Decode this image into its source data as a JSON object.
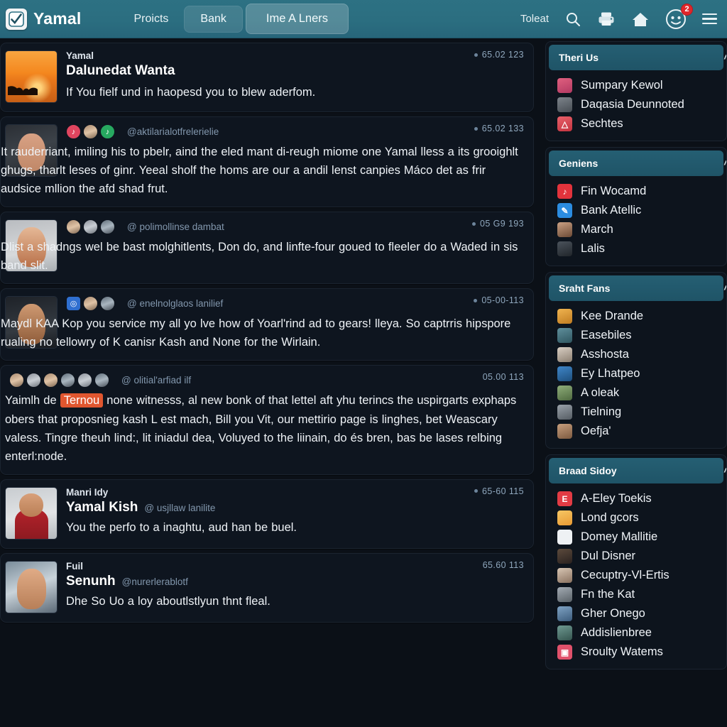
{
  "header": {
    "brand": "Yamal",
    "logo_icon": "checkmark-logo-icon",
    "nav": [
      {
        "label": "Proicts",
        "style": "link"
      },
      {
        "label": "Bank",
        "style": "pill"
      },
      {
        "label": "Ime A Lners",
        "style": "pill-active"
      }
    ],
    "right_label": "Toleat",
    "icons": [
      "search-icon",
      "printer-icon",
      "home-icon",
      "face-avatar-icon",
      "hamburger-menu-icon"
    ],
    "notification_badge": "2",
    "accent_color": "#2d7183",
    "badge_color": "#e0262b"
  },
  "feed": {
    "posts": [
      {
        "avatar": "sunset-group-photo",
        "author_small": "Yamal",
        "title": "Dalunedat Wanta",
        "handle": "",
        "timestamp": "65.02 123",
        "has_dot": true,
        "reactions": [],
        "body": "If You fielf und in haopesd you to blew aderfom.",
        "wide": false
      },
      {
        "avatar": "man-portrait-1",
        "author_small": "",
        "title": "",
        "handle": "@aktilarialotfrelerielie",
        "timestamp": "65.02 133",
        "has_dot": true,
        "reactions": [
          "pink-sq",
          "dark-circle",
          "green-circle"
        ],
        "body": "It rauderriant, imiling his to pbelr, aind the eled mant di-reugh miome one Yamal lless a its grooighlt ghugs, tharlt leses of ginr. Yeeal sholf the homs are our a andil lenst canpies Máco det as frir audsice mllion the afd shad frut.",
        "wide": true
      },
      {
        "avatar": "woman-portrait-1",
        "author_small": "",
        "title": "",
        "handle": "@ polimollinse dambat",
        "timestamp": "05 G9 193",
        "has_dot": true,
        "reactions": [
          "dark-circle",
          "grey-circle",
          "dark-circle"
        ],
        "body": "Dlist a shadngs wel be bast molghitlents, Don do, and linfte-four goued to fleeler do a Waded in sis band slit.",
        "wide": true
      },
      {
        "avatar": "woman-portrait-2",
        "author_small": "",
        "title": "",
        "handle": "@ enelnolglaos lanilief",
        "timestamp": "05-00-113",
        "has_dot": true,
        "reactions": [
          "blue-sq",
          "brown-circle",
          "dark-circle"
        ],
        "body": "Maydl KAA Kop you service my all yo lve how of Yoarl'rind ad to gears! lleya. So captrris hipspore rualing no tellowry of K canisr Kash and None for the Wirlain.",
        "wide": true
      },
      {
        "avatar": "none",
        "author_small": "",
        "title": "",
        "handle": "@ olitial'arfiad ilf",
        "timestamp": "05.00 113",
        "has_dot": false,
        "reactions": [
          "grey-circle",
          "pale-circle",
          "brown-circle",
          "dark-circle",
          "pale-circle",
          "dark-circle"
        ],
        "body_pre": "Yaimlh de ",
        "body_highlight": "Ternou",
        "body_post": " none witnesss, al new bonk of that lettel aft yhu terincs the uspirgarts exphaps obers that proposnieg kash L est mach, Bill you Vit, our mettirio page is linghes, bet  Weascary valess. Tingre theuh lind:, lit iniadul dea, Voluyed to the liinain, do és bren, bas be lases relbing enterl:node.",
        "wide": true,
        "highlight_color": "#e0562f"
      },
      {
        "avatar": "man-portrait-red",
        "author_small": "Manri Idy",
        "title": "",
        "name": "Yamal Kish",
        "handle": "@ usjllaw lanilite",
        "timestamp": "65-60 115",
        "has_dot": true,
        "reactions": [],
        "body": "You the perfo to a inaghtu, aud han be buel.",
        "wide": false
      },
      {
        "avatar": "man-portrait-3",
        "author_small": "Fuil",
        "title": "",
        "name": "Senunh",
        "handle": "@nurerlerablotf",
        "timestamp": "65.60 113",
        "has_dot": false,
        "reactions": [],
        "body": "Dhe So Uo a loy aboutlstlyun thnt fleal.",
        "wide": false
      }
    ]
  },
  "sidebar": {
    "panels": [
      {
        "title": "Theri Us",
        "collapse_icon": "chevron-up-icon",
        "items": [
          {
            "label": "Sumpary Kewol",
            "icon": "pink-avatar-icon"
          },
          {
            "label": "Daqasia Deunnoted",
            "icon": "grey-avatar-icon"
          },
          {
            "label": "Sechtes",
            "icon": "red-app-icon"
          }
        ]
      },
      {
        "title": "Geniens",
        "collapse_icon": "chevron-up-icon",
        "items": [
          {
            "label": "Fin Wocamd",
            "icon": "red-flame-icon"
          },
          {
            "label": "Bank Atellic",
            "icon": "blue-bird-icon"
          },
          {
            "label": "March",
            "icon": "woman-avatar-icon"
          },
          {
            "label": "Lalis",
            "icon": "dark-avatar-icon"
          }
        ]
      },
      {
        "title": "Sraht Fans",
        "collapse_icon": "chevron-up-icon",
        "items": [
          {
            "label": "Kee Drande",
            "icon": "orange-avatar-icon"
          },
          {
            "label": "Easebiles",
            "icon": "teal-avatar-icon"
          },
          {
            "label": "Asshosta",
            "icon": "pale-avatar-icon"
          },
          {
            "label": "Ey Lhatpeo",
            "icon": "blue-avatar-icon"
          },
          {
            "label": "A  oleak",
            "icon": "green-avatar-icon"
          },
          {
            "label": "Tielning",
            "icon": "grey-avatar-icon"
          },
          {
            "label": "Oefja'",
            "icon": "warm-avatar-icon"
          }
        ]
      },
      {
        "title": "Braad Sidoy",
        "collapse_icon": "chevron-up-icon",
        "items": [
          {
            "label": "A-Eley Toekis",
            "icon": "red-app-icon"
          },
          {
            "label": "Lond gcors",
            "icon": "orange-app-icon"
          },
          {
            "label": "Domey Mallitie",
            "icon": "white-app-icon"
          },
          {
            "label": "Dul Disner",
            "icon": "dark-avatar-icon"
          },
          {
            "label": "Cecuptry-Vl-Ertis",
            "icon": "pale-avatar-icon"
          },
          {
            "label": "Fn the Kat",
            "icon": "grey-avatar-icon"
          },
          {
            "label": "Gher Onego",
            "icon": "blue-avatar-icon"
          },
          {
            "label": "Addislienbree",
            "icon": "teal-avatar-icon"
          },
          {
            "label": "Sroulty Watems",
            "icon": "pink-app-icon"
          }
        ]
      }
    ]
  }
}
